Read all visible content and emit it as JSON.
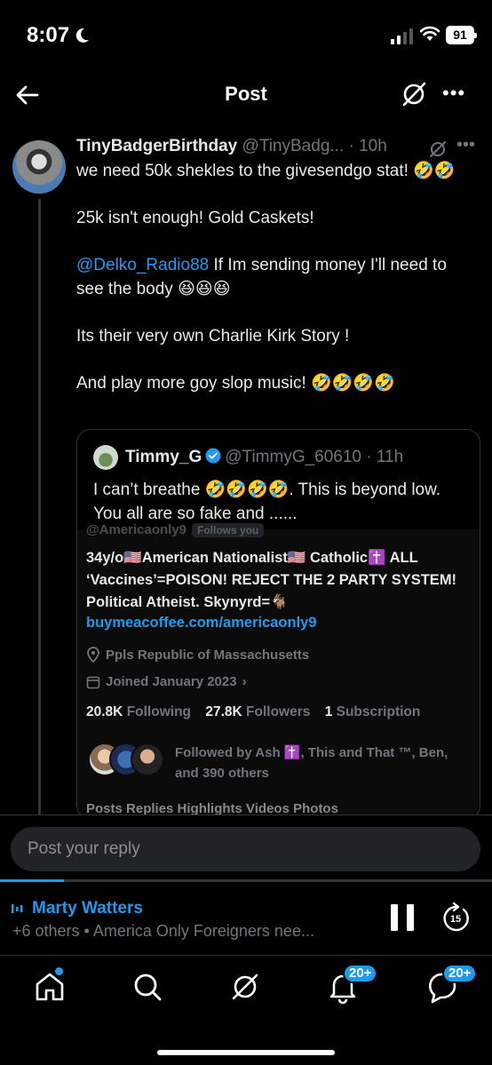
{
  "status": {
    "time": "8:07",
    "battery": "91"
  },
  "header": {
    "title": "Post"
  },
  "tweet": {
    "display_name": "TinyBadgerBirthday",
    "handle_time": "@TinyBadg... · 10h",
    "lines": [
      "we need 50k shekles to the givesendgo stat! 🤣🤣",
      "25k isn't enough! Gold Caskets!",
      "If Im sending money I'll need to see the body 😆😆😆",
      "Its their very own Charlie Kirk Story !",
      "And play more goy slop music! 🤣🤣🤣🤣"
    ],
    "mention": "@Delko_Radio88"
  },
  "quote": {
    "display_name": "Timmy_G",
    "handle_time": "@TimmyG_60610 · 11h",
    "text": "I can’t breathe 🤣🤣🤣🤣. This is beyond low. You all are so fake and ......",
    "profile": {
      "top_handle": "@Americaonly9",
      "follows_you": "Follows you",
      "bio": "34y/o🇺🇸American Nationalist🇺🇸 Catholic✝️ ALL ‘Vaccines’=POISON! REJECT THE 2 PARTY SYSTEM! Political Atheist. Skynyrd=🐐",
      "link": "buymeacoffee.com/americaonly9",
      "location": "Ppls Republic of Massachusetts",
      "joined": "Joined January 2023",
      "following_count": "20.8K",
      "following_label": "Following",
      "followers_count": "27.8K",
      "followers_label": "Followers",
      "subscription_count": "1",
      "subscription_label": "Subscription",
      "followed_by": "Followed by Ash ✝️, This and That ™, Ben, and 390 others",
      "tabs": "Posts   Replies   Highlights   Videos   Photos"
    }
  },
  "reply": {
    "placeholder": "Post your reply"
  },
  "player": {
    "title": "Marty Watters",
    "subtitle": "+6 others • America Only Foreigners nee...",
    "progress": 0.13,
    "skip_seconds": "15"
  },
  "nav": {
    "notifications_badge": "20+",
    "messages_badge": "20+"
  },
  "colors": {
    "accent": "#1d9bf0",
    "background": "#000000",
    "muted": "#71767b"
  }
}
